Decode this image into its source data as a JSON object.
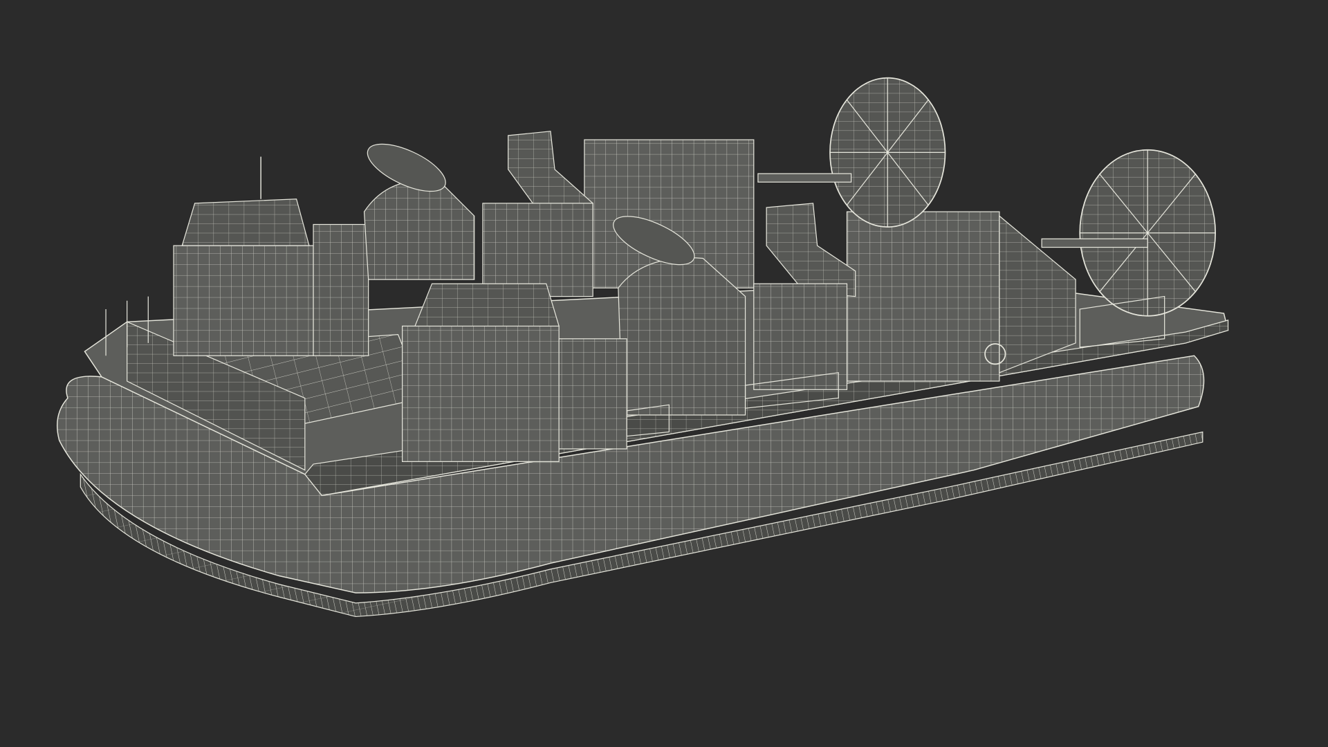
{
  "scene": {
    "subject": "hovercraft-wireframe-render",
    "background_color": "#2b2b2b",
    "model_fill_color": "#5d5e5b",
    "model_dark_fill_color": "#4a4b48",
    "wire_color": "#e6e6dc"
  }
}
